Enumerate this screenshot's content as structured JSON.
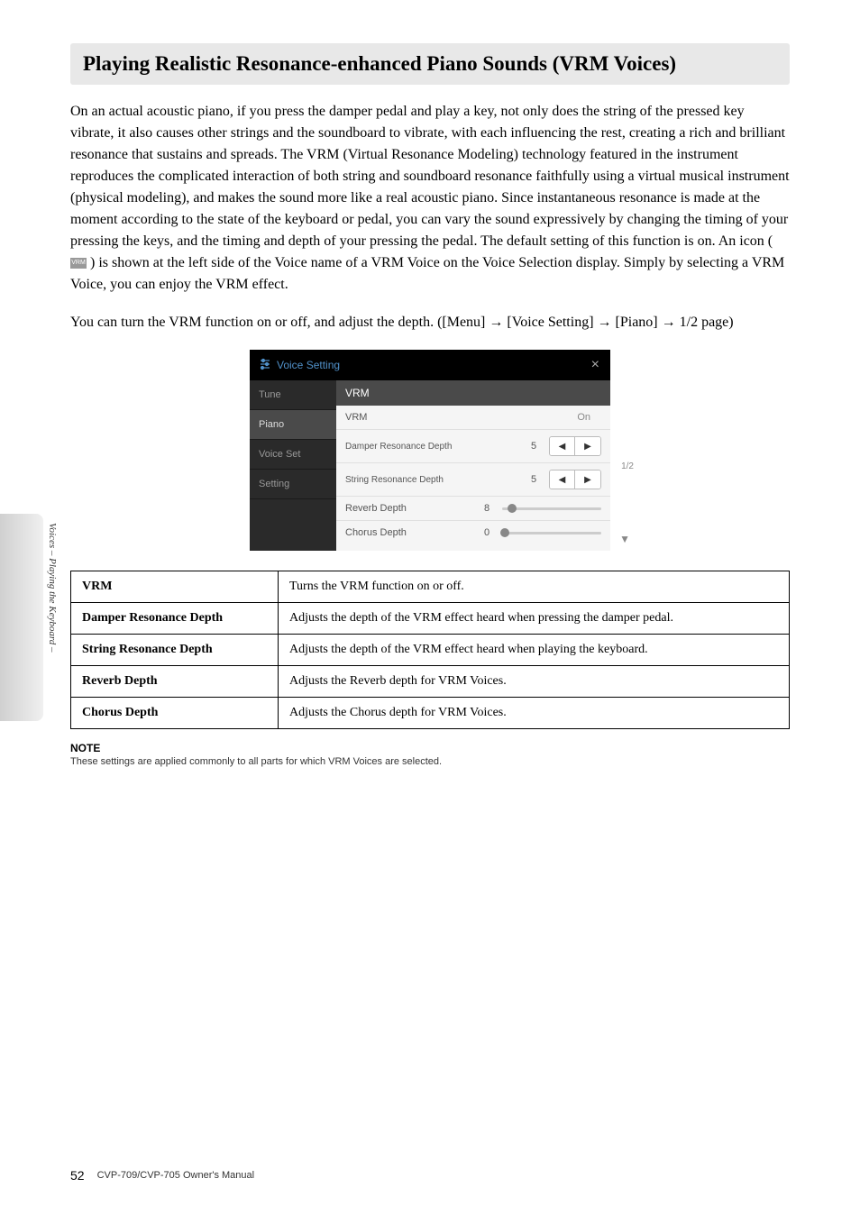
{
  "sideTab": "Voices – Playing the Keyboard –",
  "title": "Playing Realistic Resonance-enhanced Piano Sounds (VRM Voices)",
  "para1_a": "On an actual acoustic piano, if you press the damper pedal and play a key, not only does the string of the pressed key vibrate, it also causes other strings and the soundboard to vibrate, with each influencing the rest, creating a rich and brilliant resonance that sustains and spreads. The VRM (Virtual Resonance Modeling) technology featured in the instrument reproduces the complicated interaction of both string and soundboard resonance faithfully using a virtual musical instrument (physical modeling), and makes the sound more like a real acoustic piano. Since instantaneous resonance is made at the moment according to the state of the keyboard or pedal, you can vary the sound expressively by changing the timing of your pressing the keys, and the timing and depth of your pressing the pedal. The default setting of this function is on. An icon (",
  "para1_icon": "VRM",
  "para1_b": ") is shown at the left side of the Voice name of a VRM Voice on the Voice Selection display. Simply by selecting a VRM Voice, you can enjoy the VRM effect.",
  "para2": "You can turn the VRM function on or off, and adjust the depth. ([Menu] → [Voice Setting] → [Piano] → 1/2 page)",
  "screenshot": {
    "headerTitle": "Voice Setting",
    "close": "×",
    "sidebar": {
      "tune": "Tune",
      "piano": "Piano",
      "voiceSet": "Voice Set",
      "setting": "Setting"
    },
    "main": {
      "sectionTitle": "VRM",
      "vrmLabel": "VRM",
      "vrmStatus": "On",
      "damperLabel": "Damper Resonance Depth",
      "damperValue": "5",
      "stringLabel": "String Resonance Depth",
      "stringValue": "5",
      "reverbLabel": "Reverb Depth",
      "reverbValue": "8",
      "chorusLabel": "Chorus Depth",
      "chorusValue": "0",
      "pageIndicator": "1/2",
      "downArrow": "▼"
    }
  },
  "table": {
    "rows": [
      {
        "name": "VRM",
        "desc": "Turns the VRM function on or off."
      },
      {
        "name": "Damper Resonance Depth",
        "desc": "Adjusts the depth of the VRM effect heard when pressing the damper pedal."
      },
      {
        "name": "String Resonance Depth",
        "desc": "Adjusts the depth of the VRM effect heard when playing the keyboard."
      },
      {
        "name": "Reverb Depth",
        "desc": "Adjusts the Reverb depth for VRM Voices."
      },
      {
        "name": "Chorus Depth",
        "desc": "Adjusts the Chorus depth for VRM Voices."
      }
    ]
  },
  "note": {
    "heading": "NOTE",
    "text": "These settings are applied commonly to all parts for which VRM Voices are selected."
  },
  "footer": {
    "pageNum": "52",
    "manual": "CVP-709/CVP-705 Owner's Manual"
  }
}
